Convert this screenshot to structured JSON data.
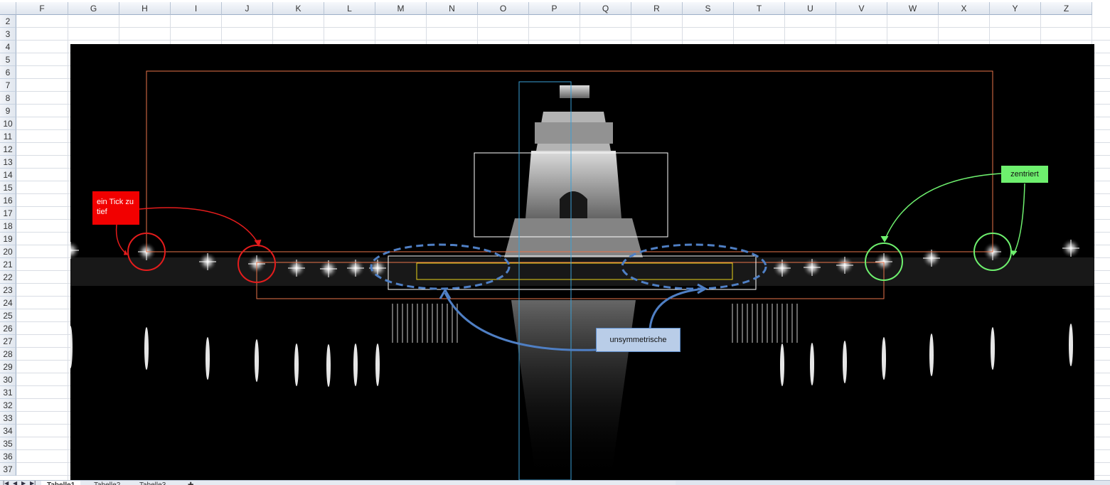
{
  "columns": [
    "F",
    "G",
    "H",
    "I",
    "J",
    "K",
    "L",
    "M",
    "N",
    "O",
    "P",
    "Q",
    "R",
    "S",
    "T",
    "U",
    "V",
    "W",
    "X",
    "Y",
    "Z"
  ],
  "rows": [
    "2",
    "3",
    "4",
    "5",
    "6",
    "7",
    "8",
    "9",
    "10",
    "11",
    "12",
    "13",
    "14",
    "15",
    "16",
    "17",
    "18",
    "19",
    "20",
    "21",
    "22",
    "23",
    "24",
    "25",
    "26",
    "27",
    "28",
    "29",
    "30",
    "31",
    "32",
    "33",
    "34",
    "35",
    "36",
    "37"
  ],
  "annotations": {
    "red_label": "ein Tick zu tief",
    "green_label": "zentriert",
    "blue_label": "unsymmetrische"
  },
  "sheet_tabs": [
    "Tabelle1",
    "Tabelle2",
    "Tabelle3"
  ],
  "colors": {
    "red": "#f20000",
    "green": "#6ef06e",
    "blue": "#5b8ac8",
    "orange_guide": "#e8744a",
    "yellow_guide": "#e8d21a",
    "cyan_axis": "#3a9fd6"
  }
}
